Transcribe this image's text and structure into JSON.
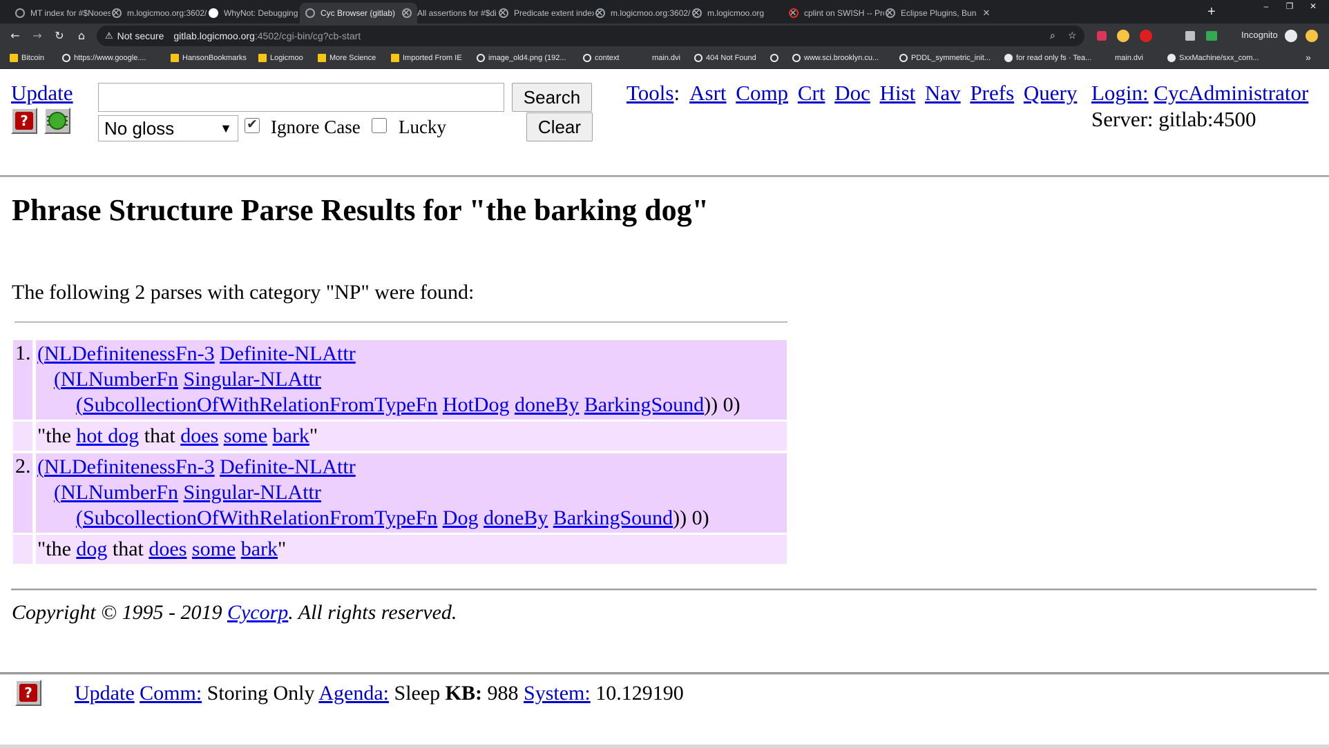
{
  "browser": {
    "tabs": [
      {
        "title": "MT index for #$Nooes"
      },
      {
        "title": "m.logicmoo.org:3602/"
      },
      {
        "title": "WhyNot: Debugging P"
      },
      {
        "title": "Cyc Browser (gitlab)"
      },
      {
        "title": "All assertions for #$di"
      },
      {
        "title": "Predicate extent index"
      },
      {
        "title": "m.logicmoo.org:3602/"
      },
      {
        "title": "m.logicmoo.org"
      },
      {
        "title": "cplint on SWISH -- Pro"
      },
      {
        "title": "Eclipse Plugins, Bun"
      }
    ],
    "active_tab_index": 3,
    "new_tab": "+",
    "window_controls": {
      "minimize": "–",
      "restore": "❐",
      "close": "✕"
    },
    "address": {
      "warning": "⚠",
      "security": "Not secure",
      "host": "gitlab.logicmoo.org",
      "path": ":4502/cgi-bin/cg?cb-start"
    },
    "incognito_label": "Incognito",
    "bookmarks": [
      {
        "label": "Bitcoin",
        "icon": "folder"
      },
      {
        "label": "https://www.google....",
        "icon": "globe"
      },
      {
        "label": "HansonBookmarks",
        "icon": "folder"
      },
      {
        "label": "Logicmoo",
        "icon": "folder"
      },
      {
        "label": "More Science",
        "icon": "folder"
      },
      {
        "label": "Imported From IE",
        "icon": "folder"
      },
      {
        "label": "image_old4.png (192...",
        "icon": "globe"
      },
      {
        "label": "context",
        "icon": "globe"
      },
      {
        "label": "main.dvi",
        "icon": "none"
      },
      {
        "label": "404 Not Found",
        "icon": "globe"
      },
      {
        "label": "",
        "icon": "globe"
      },
      {
        "label": "www.sci.brooklyn.cu...",
        "icon": "globe"
      },
      {
        "label": "PDDL_symmetric_init...",
        "icon": "globe"
      },
      {
        "label": "for read only fs · Tea...",
        "icon": "gh"
      },
      {
        "label": "main.dvi",
        "icon": "none"
      },
      {
        "label": "SxxMachine/sxx_com...",
        "icon": "gh"
      }
    ],
    "bookmarks_more": "»"
  },
  "header": {
    "update_label": "Update",
    "search_button": "Search",
    "clear_button": "Clear",
    "search_value": "",
    "gloss_selected": "No gloss",
    "ignore_case_label": "Ignore Case",
    "lucky_label": "Lucky",
    "tools_label": "Tools",
    "tools_colon": ":",
    "tool_links": [
      "Asrt",
      "Comp",
      "Crt",
      "Doc",
      "Hist",
      "Nav",
      "Prefs",
      "Query"
    ],
    "login_label": "Login:",
    "login_user": "CycAdministrator",
    "server_text": "Server: gitlab:4500"
  },
  "main": {
    "heading": "Phrase Structure Parse Results for \"the barking dog\"",
    "intro": "The following 2 parses with category \"NP\" were found:",
    "results": [
      {
        "number": "1.",
        "l1": {
          "open": "(",
          "fn": "NLDefinitenessFn-3",
          "arg": "Definite-NLAttr"
        },
        "l2": {
          "open": "(",
          "fn": "NLNumberFn",
          "arg": "Singular-NLAttr"
        },
        "l3": {
          "open": "(",
          "fn": "SubcollectionOfWithRelationFromTypeFn",
          "a1": "HotDog",
          "a2": "doneBy",
          "a3": "BarkingSound",
          "close": ")) 0)"
        },
        "para": {
          "q1": "\"the ",
          "w1": "hot dog",
          "t1": " that ",
          "w2": "does",
          "t2": " ",
          "w3": "some",
          "t3": " ",
          "w4": "bark",
          "q2": "\""
        }
      },
      {
        "number": "2.",
        "l1": {
          "open": "(",
          "fn": "NLDefinitenessFn-3",
          "arg": "Definite-NLAttr"
        },
        "l2": {
          "open": "(",
          "fn": "NLNumberFn",
          "arg": "Singular-NLAttr"
        },
        "l3": {
          "open": "(",
          "fn": "SubcollectionOfWithRelationFromTypeFn",
          "a1": "Dog",
          "a2": "doneBy",
          "a3": "BarkingSound",
          "close": ")) 0)"
        },
        "para": {
          "q1": "\"the ",
          "w1": "dog",
          "t1": " that ",
          "w2": "does",
          "t2": " ",
          "w3": "some",
          "t3": " ",
          "w4": "bark",
          "q2": "\""
        }
      }
    ],
    "copyright_pre": "Copyright © 1995 - 2019 ",
    "copyright_link": "Cycorp",
    "copyright_post": ". All rights reserved."
  },
  "footer": {
    "update": "Update",
    "comm_label": "Comm:",
    "comm_value": "Storing Only",
    "agenda_label": "Agenda:",
    "agenda_value": "Sleep",
    "kb_label": "KB:",
    "kb_value": "988",
    "system_label": "System:",
    "system_value": "10.129190"
  }
}
